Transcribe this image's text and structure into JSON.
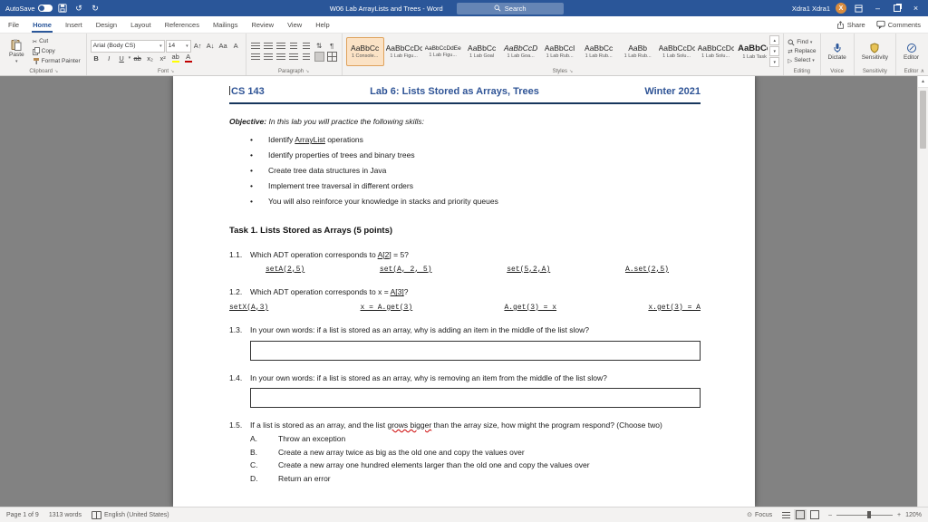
{
  "icons": {
    "dropdown": "▾",
    "launcher": "↘",
    "cut": "✂",
    "undo": "↺",
    "redo": "↻",
    "minimize": "–",
    "close": "×",
    "up": "▴",
    "down": "▾",
    "more": "▾",
    "collapse": "∧",
    "replace": "⇄",
    "select": "▷",
    "sort": "⇅",
    "pilcrow": "¶",
    "scroll_up": "▲",
    "zoom_out": "–",
    "zoom_in": "+",
    "focus": "⊙",
    "bullet": "•"
  },
  "titlebar": {
    "autosave_label": "AutoSave",
    "autosave_state": "Off",
    "title": "W06 Lab ArrayLists and Trees - Word",
    "search_placeholder": "Search",
    "user_name": "Xdra1 Xdra1",
    "user_initial": "X"
  },
  "menubar": {
    "tabs": [
      {
        "label": "File"
      },
      {
        "label": "Home",
        "active": true
      },
      {
        "label": "Insert"
      },
      {
        "label": "Design"
      },
      {
        "label": "Layout"
      },
      {
        "label": "References"
      },
      {
        "label": "Mailings"
      },
      {
        "label": "Review"
      },
      {
        "label": "View"
      },
      {
        "label": "Help"
      }
    ],
    "share": "Share",
    "comments": "Comments"
  },
  "ribbon": {
    "clipboard": {
      "label": "Clipboard",
      "paste": "Paste",
      "cut": "Cut",
      "copy": "Copy",
      "format_painter": "Format Painter"
    },
    "font": {
      "label": "Font",
      "name": "Arial (Body CS)",
      "size": "14",
      "grow": "A↑",
      "shrink": "A↓",
      "change_case": "Aa",
      "clear": "A",
      "bold": "B",
      "italic": "I",
      "underline": "U",
      "strike": "ab",
      "sub": "x₂",
      "sup": "x²",
      "highlight": "ab",
      "color": "A"
    },
    "paragraph_label": "Paragraph",
    "styles_label": "Styles",
    "styles": [
      {
        "preview": "AaBbCc",
        "label": "1 Console...",
        "selected": true
      },
      {
        "preview": "AaBbCcDc",
        "label": "1 Lab Figu..."
      },
      {
        "preview": "AaBbCcDdEe",
        "label": "1 Lab Figu...",
        "small": true
      },
      {
        "preview": "AaBbCc",
        "label": "1 Lab Goal"
      },
      {
        "preview": "AaBbCcD",
        "label": "1 Lab Goa...",
        "italic": true
      },
      {
        "preview": "AaBbCcI",
        "label": "1 Lab Rub..."
      },
      {
        "preview": "AaBbCc",
        "label": "1 Lab Rub..."
      },
      {
        "preview": "AaBb",
        "label": "1 Lab Rub..."
      },
      {
        "preview": "AaBbCcDc",
        "label": "1 Lab Solu..."
      },
      {
        "preview": "AaBbCcDc",
        "label": "1 Lab Solu..."
      },
      {
        "preview": "AaBbCc",
        "label": "1 Lab Task",
        "bold": true
      }
    ],
    "find": "Find",
    "replace": "Replace",
    "select": "Select",
    "editing_label": "Editing",
    "dictate": "Dictate",
    "voice_label": "Voice",
    "sensitivity": "Sensitivity",
    "sensitivity_label": "Sensitivity",
    "editor": "Editor",
    "editor_label": "Editor"
  },
  "document": {
    "course": "CS 143",
    "title": "Lab 6: Lists Stored as Arrays, Trees",
    "term": "Winter 2021",
    "objective_label": "Objective:",
    "objective_text": " In this lab you will practice the following skills:",
    "bullets": [
      {
        "pre": "Identify ",
        "link": "ArrayList",
        "post": " operations"
      },
      {
        "text": "Identify properties of trees and binary trees"
      },
      {
        "text": "Create tree data structures in Java"
      },
      {
        "text": "Implement tree traversal in different orders"
      },
      {
        "text": "You will also reinforce your knowledge in stacks and priority queues"
      }
    ],
    "task_heading": "Task 1. Lists Stored as Arrays (5 points)",
    "q1": {
      "num": "1.1.",
      "text_pre": "Which ADT operation corresponds to ",
      "text_u": "A[2]",
      "text_post": " = 5?",
      "options": [
        "setA(2,5)",
        "set(A, 2, 5)",
        "set(5,2,A)",
        "A.set(2,5)"
      ]
    },
    "q2": {
      "num": "1.2.",
      "text_pre": "Which ADT operation corresponds to x = ",
      "text_u": "A[3]",
      "text_post": "?",
      "options": [
        "setX(A,3)",
        "x = A.get(3)",
        "A.get(3) = x",
        "x.get(3) = A"
      ]
    },
    "q3": {
      "num": "1.3.",
      "text": "In your own words: if a list is stored as an array, why is adding an item in the middle of the list slow?"
    },
    "q4": {
      "num": "1.4.",
      "text": "In your own words: if a list is stored as an array, why is removing an item from the middle of the list slow?"
    },
    "q5": {
      "num": "1.5.",
      "text_pre": "If a list is stored as an array, and the list ",
      "text_sp": "grows bigger",
      "text_post": " than the array size, how might the program respond? (Choose two)",
      "choices": [
        {
          "letter": "A.",
          "text": "Throw an exception"
        },
        {
          "letter": "B.",
          "text": "Create a new array twice as big as the old one and copy the values over"
        },
        {
          "letter": "C.",
          "text": "Create a new array one hundred elements larger than the old one and copy the values over"
        },
        {
          "letter": "D.",
          "text": "Return an error"
        }
      ]
    }
  },
  "statusbar": {
    "page_info": "Page 1 of 9",
    "word_count": "1313 words",
    "language": "English (United States)",
    "focus": "Focus",
    "zoom": "120%"
  }
}
